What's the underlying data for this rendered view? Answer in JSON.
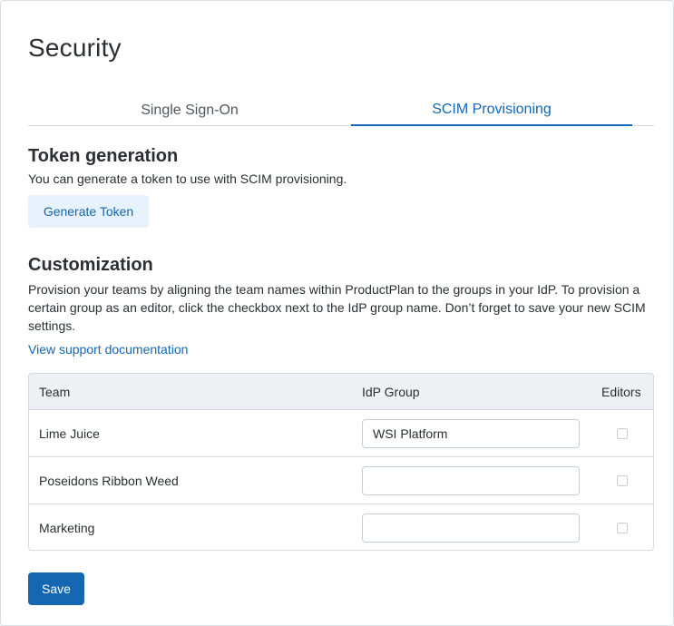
{
  "page": {
    "title": "Security"
  },
  "tabs": [
    {
      "label": "Single Sign-On",
      "active": false
    },
    {
      "label": "SCIM Provisioning",
      "active": true
    }
  ],
  "token": {
    "title": "Token generation",
    "description": "You can generate a token to use with SCIM provisioning.",
    "button_label": "Generate Token"
  },
  "customization": {
    "title": "Customization",
    "description": "Provision your teams by aligning the team names within ProductPlan to the groups in your IdP.  To provision a certain group as an editor, click the checkbox next to the IdP group name. Don’t forget to save your new SCIM settings.",
    "link_label": "View support documentation"
  },
  "table": {
    "headers": {
      "team": "Team",
      "idp_group": "IdP Group",
      "editors": "Editors"
    },
    "rows": [
      {
        "team": "Lime Juice",
        "idp_group": "WSI Platform",
        "editor": false
      },
      {
        "team": "Poseidons Ribbon Weed",
        "idp_group": "",
        "editor": false
      },
      {
        "team": "Marketing",
        "idp_group": "",
        "editor": false
      }
    ]
  },
  "actions": {
    "save_label": "Save"
  },
  "colors": {
    "accent": "#1467b0",
    "accent_light": "#e8f2fc",
    "header_bg": "#eef1f4",
    "border": "#d5d9dd"
  }
}
